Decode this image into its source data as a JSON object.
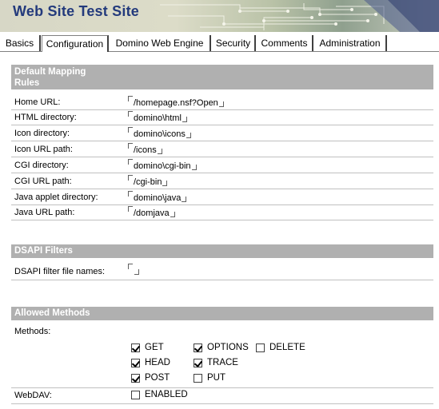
{
  "window": {
    "title": "Web Site Test Site"
  },
  "tabs": [
    {
      "label": "Basics"
    },
    {
      "label": "Configuration"
    },
    {
      "label": "Domino Web Engine"
    },
    {
      "label": "Security"
    },
    {
      "label": "Comments"
    },
    {
      "label": "Administration"
    }
  ],
  "active_tab": "Configuration",
  "sections": {
    "mapping": {
      "header": "Default Mapping Rules",
      "rows": [
        {
          "label": "Home URL:",
          "value": "/homepage.nsf?Open"
        },
        {
          "label": "HTML directory:",
          "value": "domino\\html"
        },
        {
          "label": "Icon directory:",
          "value": "domino\\icons"
        },
        {
          "label": "Icon URL path:",
          "value": "/icons"
        },
        {
          "label": "CGI directory:",
          "value": "domino\\cgi-bin"
        },
        {
          "label": "CGI URL path:",
          "value": "/cgi-bin"
        },
        {
          "label": "Java applet directory:",
          "value": "domino\\java"
        },
        {
          "label": "Java URL path:",
          "value": "/domjava"
        }
      ]
    },
    "dsapi": {
      "header": "DSAPI Filters",
      "rows": [
        {
          "label": "DSAPI filter file names:",
          "value": ""
        }
      ]
    },
    "methods": {
      "header": "Allowed Methods",
      "methods_label": "Methods:",
      "options": [
        {
          "label": "GET",
          "checked": true
        },
        {
          "label": "OPTIONS",
          "checked": true
        },
        {
          "label": "DELETE",
          "checked": false
        },
        {
          "label": "HEAD",
          "checked": true
        },
        {
          "label": "TRACE",
          "checked": true
        },
        {
          "label": "POST",
          "checked": true
        },
        {
          "label": "PUT",
          "checked": false
        }
      ],
      "webdav_label": "WebDAV:",
      "webdav_option": {
        "label": "ENABLED",
        "checked": false
      }
    }
  },
  "colors": {
    "title_text": "#233a7c",
    "section_header_bg": "#b0b0b0",
    "section_header_text": "#ffffff"
  }
}
